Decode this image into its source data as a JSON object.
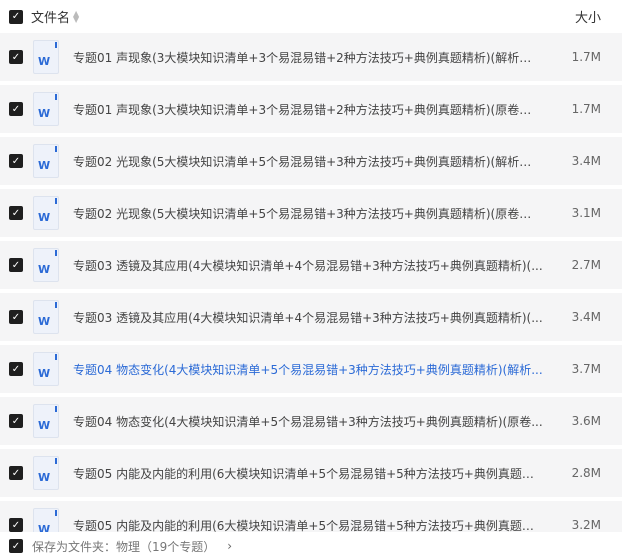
{
  "header": {
    "name_label": "文件名",
    "size_label": "大小",
    "checkbox": "✓"
  },
  "files": [
    {
      "name": "专题01 声现象(3大模块知识清单+3个易混易错+2种方法技巧+典例真题精析)(解析版)...",
      "size": "1.7M"
    },
    {
      "name": "专题01 声现象(3大模块知识清单+3个易混易错+2种方法技巧+典例真题精析)(原卷版)...",
      "size": "1.7M"
    },
    {
      "name": "专题02 光现象(5大模块知识清单+5个易混易错+3种方法技巧+典例真题精析)(解析版)...",
      "size": "3.4M"
    },
    {
      "name": "专题02 光现象(5大模块知识清单+5个易混易错+3种方法技巧+典例真题精析)(原卷版)...",
      "size": "3.1M"
    },
    {
      "name": "专题03 透镜及其应用(4大模块知识清单+4个易混易错+3种方法技巧+典例真题精析)(...",
      "size": "2.7M"
    },
    {
      "name": "专题03 透镜及其应用(4大模块知识清单+4个易混易错+3种方法技巧+典例真题精析)(...",
      "size": "3.4M"
    },
    {
      "name": "专题04 物态变化(4大模块知识清单+5个易混易错+3种方法技巧+典例真题精析)(解析...",
      "size": "3.7M"
    },
    {
      "name": "专题04 物态变化(4大模块知识清单+5个易混易错+3种方法技巧+典例真题精析)(原卷...",
      "size": "3.6M"
    },
    {
      "name": "专题05 内能及内能的利用(6大模块知识清单+5个易混易错+5种方法技巧+典例真题精...",
      "size": "2.8M"
    },
    {
      "name": "专题05 内能及内能的利用(6大模块知识清单+5个易混易错+5种方法技巧+典例真题精...",
      "size": "3.2M"
    }
  ],
  "doc_icon_letter": "W",
  "footer": {
    "label": "保存为文件夹：物理（19个专题）",
    "chevron": "›"
  },
  "colors": {
    "accent": "#2b6ad6",
    "row_bg": "#f5f5f6"
  }
}
